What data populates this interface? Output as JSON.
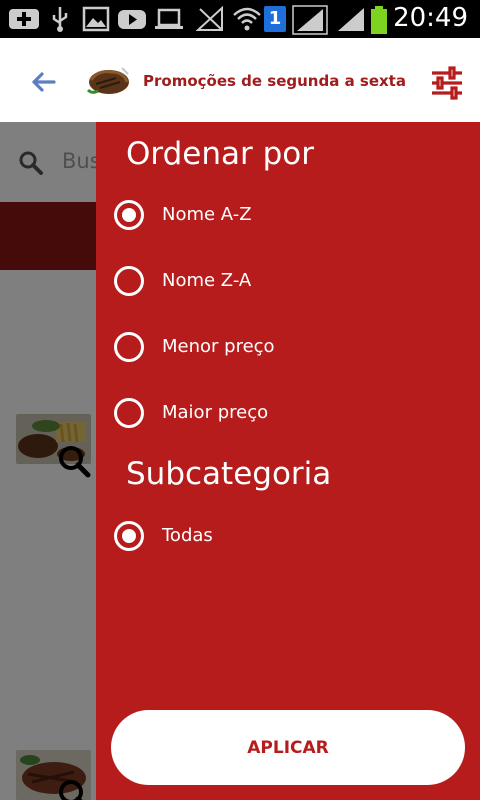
{
  "status_bar": {
    "time": "20:49",
    "notification_badge": "1"
  },
  "app_bar": {
    "title": "Promoções de segunda a sexta",
    "back_icon": "arrow-back-icon",
    "filter_icon": "tune-icon",
    "accent_color": "#b71c1c"
  },
  "background": {
    "search_placeholder": "Bus",
    "category_color": "#8b1414"
  },
  "filter_drawer": {
    "sort_title": "Ordenar por",
    "sort_options": [
      {
        "label": "Nome A-Z",
        "selected": true
      },
      {
        "label": "Nome Z-A",
        "selected": false
      },
      {
        "label": "Menor preço",
        "selected": false
      },
      {
        "label": "Maior preço",
        "selected": false
      }
    ],
    "subcategory_title": "Subcategoria",
    "subcategory_options": [
      {
        "label": "Todas",
        "selected": true
      }
    ],
    "apply_label": "APLICAR",
    "drawer_color": "#b71c1c"
  }
}
